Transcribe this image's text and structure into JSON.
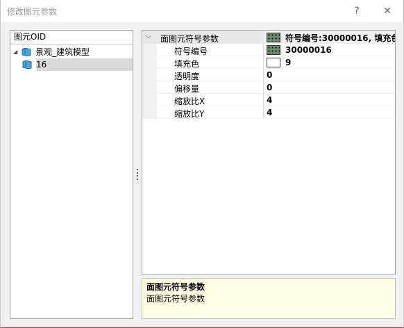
{
  "window": {
    "title": "修改图元参数",
    "help_label": "?",
    "close_label": "✕"
  },
  "tree": {
    "header": "图元OID",
    "root": {
      "label": "景观_建筑模型",
      "expanded": true
    },
    "children": [
      {
        "label": "16",
        "selected": true
      }
    ]
  },
  "properties": {
    "category": {
      "name": "面图元符号参数",
      "value": "符号编号:30000016, 填充色"
    },
    "rows": [
      {
        "name": "符号编号",
        "value": "30000016",
        "swatch": "symbol"
      },
      {
        "name": "填充色",
        "value": "9",
        "swatch": "fill"
      },
      {
        "name": "透明度",
        "value": "0"
      },
      {
        "name": "偏移量",
        "value": "0"
      },
      {
        "name": "缩放比X",
        "value": "4"
      },
      {
        "name": "缩放比Y",
        "value": "4"
      }
    ]
  },
  "description": {
    "title": "面图元符号参数",
    "text": "面图元符号参数"
  },
  "colors": {
    "description_bg": "#ffffe6",
    "selected_bg": "#d9d9d9",
    "symbol_swatch": "#6d8a72"
  }
}
